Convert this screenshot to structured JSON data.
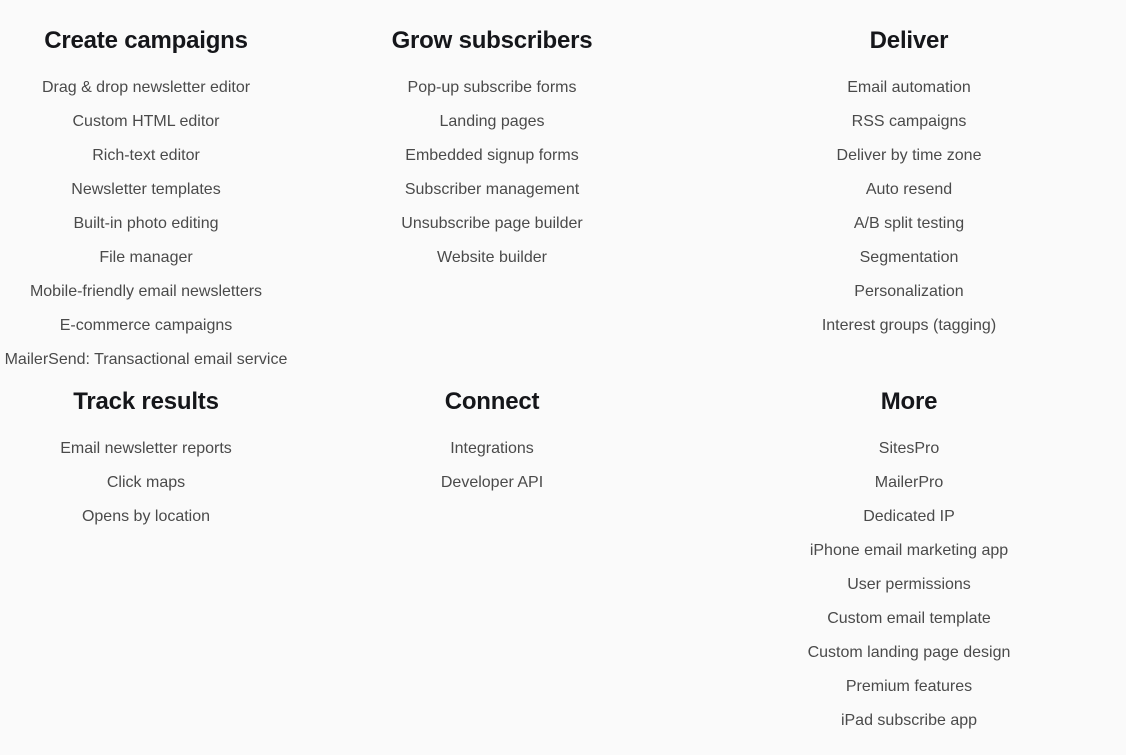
{
  "page": {
    "background_color": "#fafafa",
    "heading_color": "#15161a",
    "link_color": "#4a4a4a"
  },
  "sitemap": {
    "columns": [
      {
        "heading": "Create campaigns",
        "links": [
          "Drag & drop newsletter editor",
          "Custom HTML editor",
          "Rich-text editor",
          "Newsletter templates",
          "Built-in photo editing",
          "File manager",
          "Mobile-friendly email newsletters",
          "E-commerce campaigns",
          "MailerSend: Transactional email service"
        ]
      },
      {
        "heading": "Grow subscribers",
        "links": [
          "Pop-up subscribe forms",
          "Landing pages",
          "Embedded signup forms",
          "Subscriber management",
          "Unsubscribe page builder",
          "Website builder"
        ]
      },
      {
        "heading": "Deliver",
        "links": [
          "Email automation",
          "RSS campaigns",
          "Deliver by time zone",
          "Auto resend",
          "A/B split testing",
          "Segmentation",
          "Personalization",
          "Interest groups (tagging)"
        ]
      },
      {
        "heading": "Track results",
        "links": [
          "Email newsletter reports",
          "Click maps",
          "Opens by location"
        ]
      },
      {
        "heading": "Connect",
        "links": [
          "Integrations",
          "Developer API"
        ]
      },
      {
        "heading": "More",
        "links": [
          "SitesPro",
          "MailerPro",
          "Dedicated IP",
          "iPhone email marketing app",
          "User permissions",
          "Custom email template",
          "Custom landing page design",
          "Premium features",
          "iPad subscribe app"
        ]
      }
    ]
  }
}
